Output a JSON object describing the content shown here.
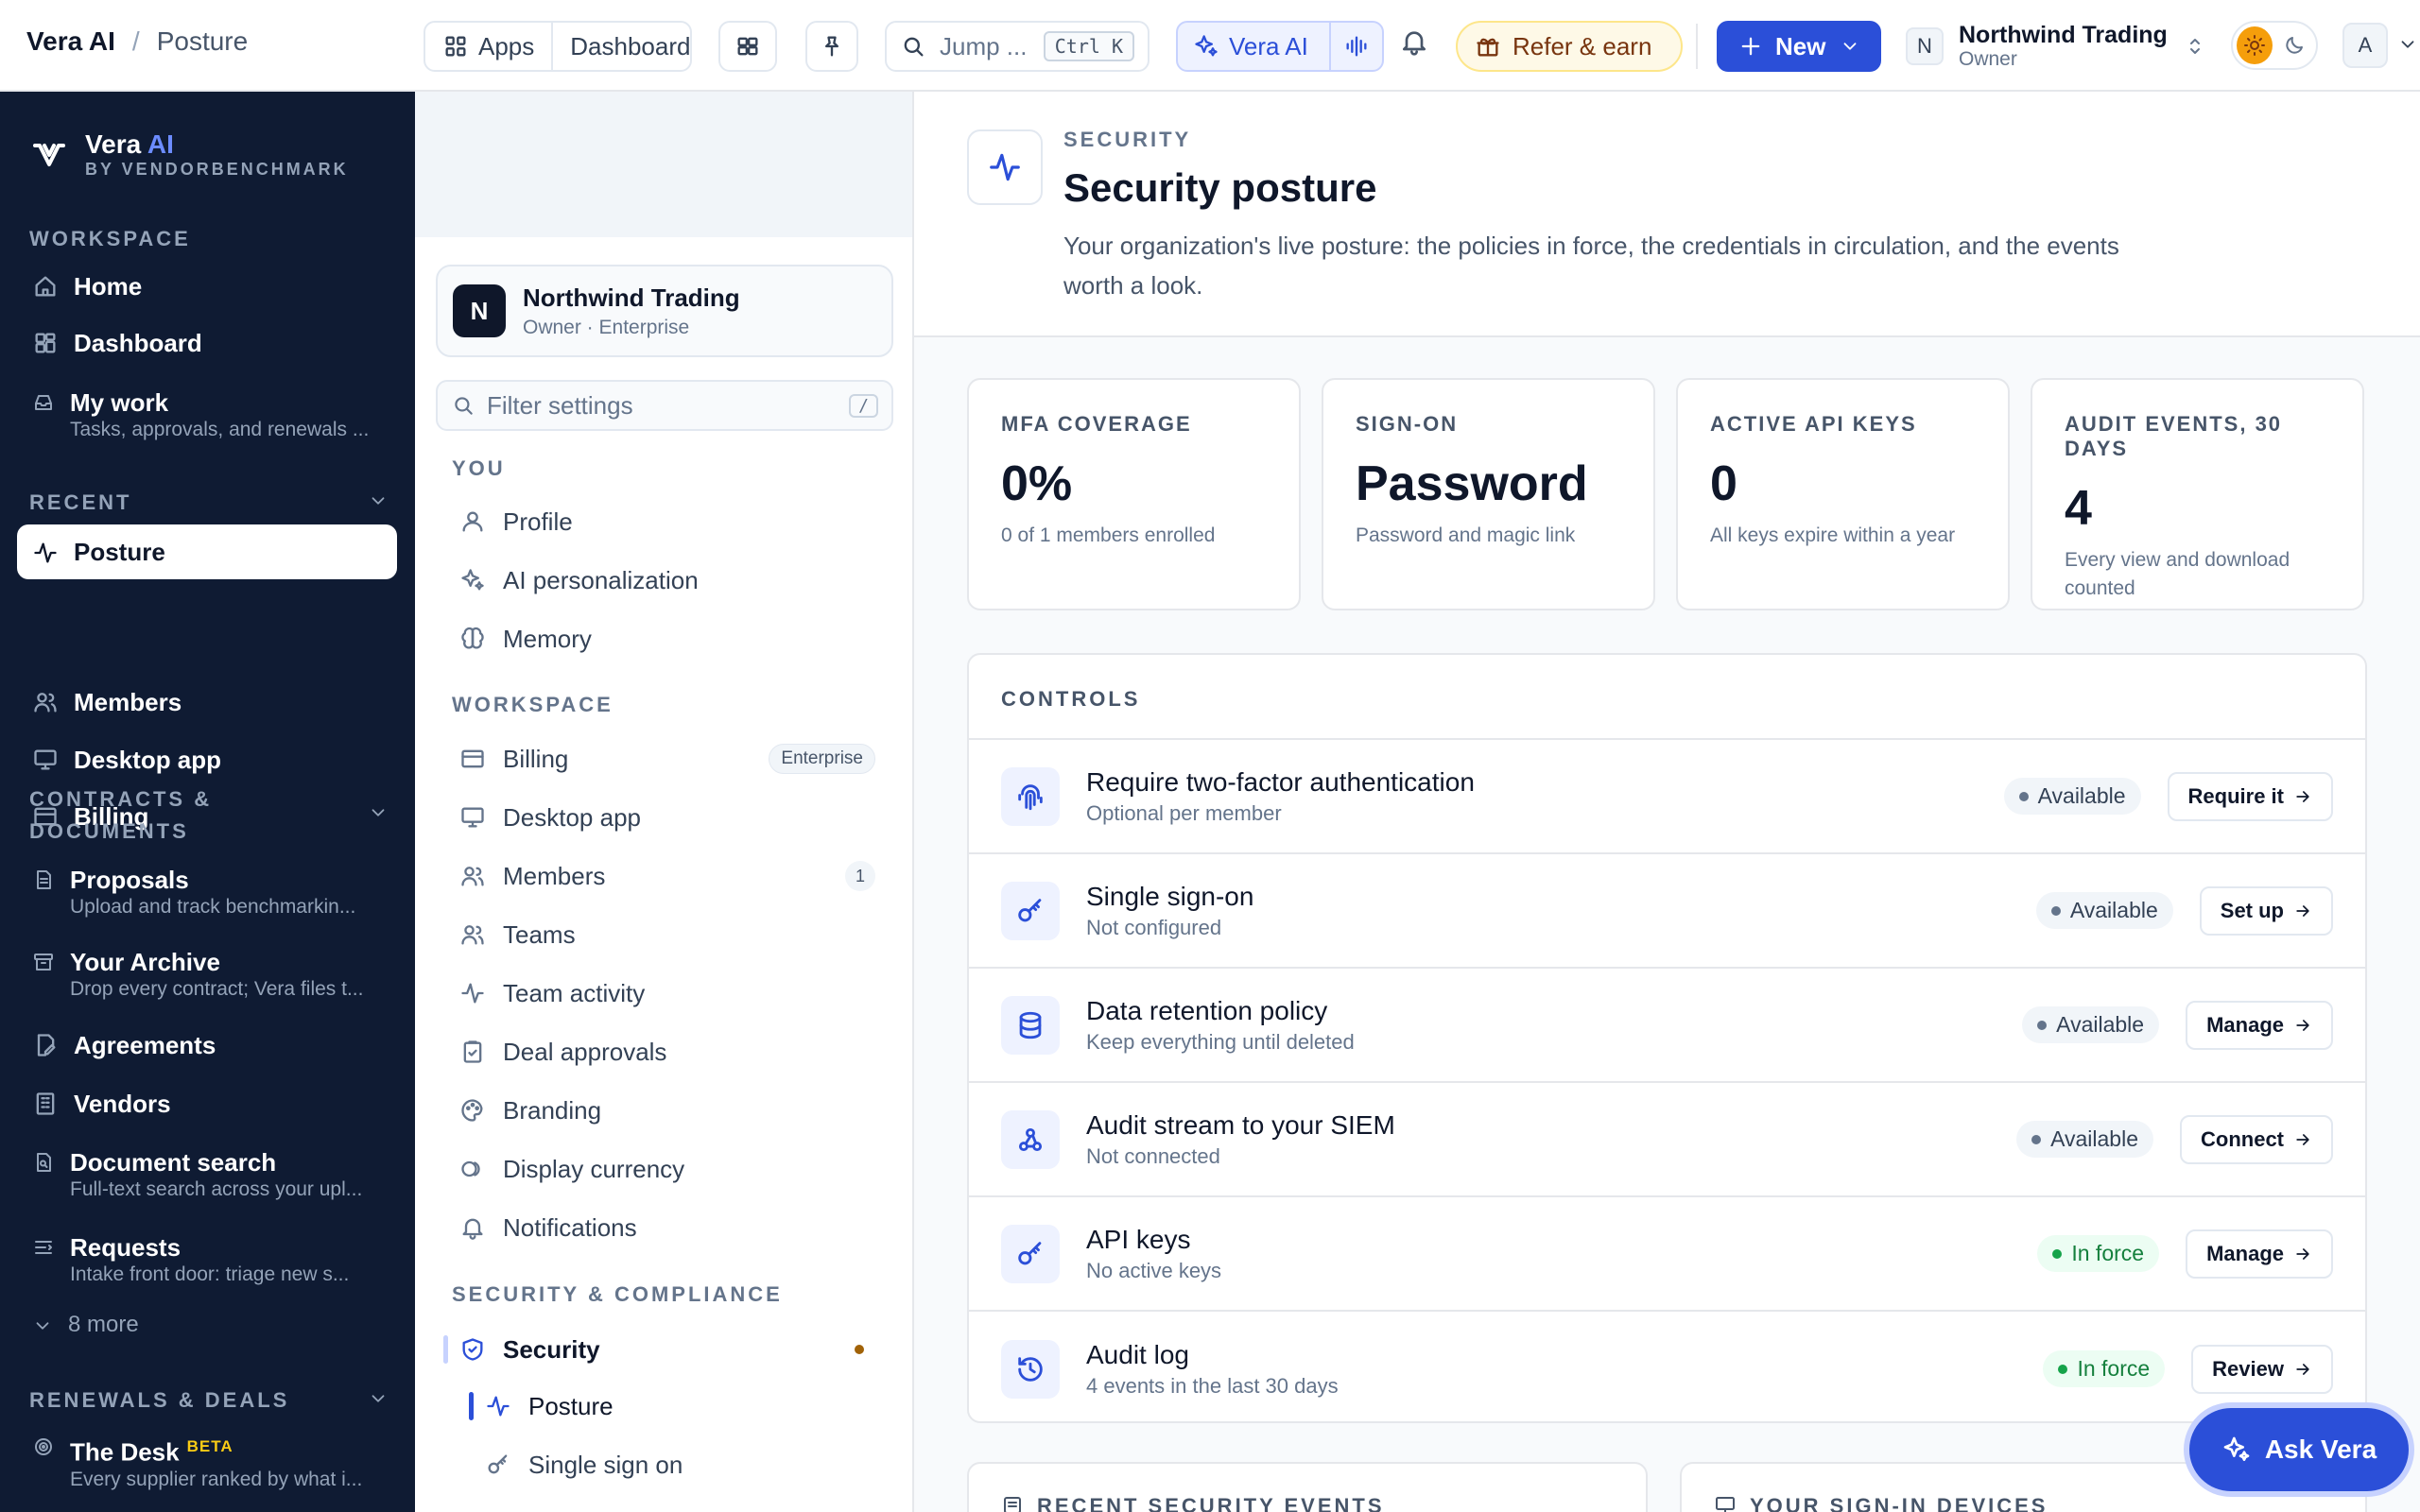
{
  "breadcrumb": {
    "app": "Vera AI",
    "separator": "/",
    "page": "Posture"
  },
  "topbar": {
    "apps_label": "Apps",
    "dashboard_label": "Dashboard",
    "search_placeholder": "Jump ...",
    "search_shortcut": "Ctrl K",
    "vera_label": "Vera AI",
    "refer_label": "Refer & earn",
    "new_label": "New",
    "org_initial": "N",
    "org_name": "Northwind Trading",
    "org_role": "Owner",
    "user_initial": "A"
  },
  "sidebar": {
    "brand_name": "Vera",
    "brand_ai": "AI",
    "brand_sub": "BY VENDORBENCHMARK",
    "workspace_heading": "WORKSPACE",
    "workspace_items": [
      {
        "label": "Home",
        "sub": ""
      },
      {
        "label": "Dashboard",
        "sub": ""
      },
      {
        "label": "My work",
        "sub": "Tasks, approvals, and renewals ..."
      }
    ],
    "recent_heading": "RECENT",
    "recent_items": [
      {
        "label": "Posture"
      },
      {
        "label": "Members"
      },
      {
        "label": "Desktop app"
      },
      {
        "label": "Billing"
      }
    ],
    "contracts_heading_1": "CONTRACTS &",
    "contracts_heading_2": "DOCUMENTS",
    "contracts_items": [
      {
        "label": "Proposals",
        "sub": "Upload and track benchmarkin..."
      },
      {
        "label": "Your Archive",
        "sub": "Drop every contract; Vera files t..."
      },
      {
        "label": "Agreements",
        "sub": ""
      },
      {
        "label": "Vendors",
        "sub": ""
      },
      {
        "label": "Document search",
        "sub": "Full-text search across your upl..."
      },
      {
        "label": "Requests",
        "sub": "Intake front door: triage new s..."
      }
    ],
    "more_label": "8 more",
    "renewals_heading": "RENEWALS & DEALS",
    "desk_label": "The Desk",
    "desk_badge": "BETA",
    "desk_sub": "Every supplier ranked by what i..."
  },
  "settings_nav": {
    "org_initial": "N",
    "org_name": "Northwind Trading",
    "org_meta": "Owner · Enterprise",
    "filter_placeholder": "Filter settings",
    "filter_shortcut": "/",
    "you_heading": "YOU",
    "you_items": [
      "Profile",
      "AI personalization",
      "Memory"
    ],
    "workspace_heading": "WORKSPACE",
    "billing_label": "Billing",
    "billing_badge": "Enterprise",
    "desktop_label": "Desktop app",
    "members_label": "Members",
    "members_count": "1",
    "teams_label": "Teams",
    "team_activity_label": "Team activity",
    "deal_approvals_label": "Deal approvals",
    "branding_label": "Branding",
    "display_currency_label": "Display currency",
    "notifications_label": "Notifications",
    "security_heading": "SECURITY & COMPLIANCE",
    "security_label": "Security",
    "posture_label": "Posture",
    "sso_label": "Single sign on"
  },
  "header": {
    "overline": "SECURITY",
    "title": "Security posture",
    "description": "Your organization's live posture: the policies in force, the credentials in circulation, and the events worth a look."
  },
  "stats": [
    {
      "label": "MFA COVERAGE",
      "value": "0%",
      "help": "0 of 1 members enrolled"
    },
    {
      "label": "SIGN-ON",
      "value": "Password",
      "help": "Password and magic link"
    },
    {
      "label": "ACTIVE API KEYS",
      "value": "0",
      "help": "All keys expire within a year"
    },
    {
      "label": "AUDIT EVENTS, 30 DAYS",
      "value": "4",
      "help": "Every view and download counted"
    }
  ],
  "controls": {
    "heading": "CONTROLS",
    "rows": [
      {
        "title": "Require two-factor authentication",
        "sub": "Optional per member",
        "status": "Available",
        "action": "Require it"
      },
      {
        "title": "Single sign-on",
        "sub": "Not configured",
        "status": "Available",
        "action": "Set up"
      },
      {
        "title": "Data retention policy",
        "sub": "Keep everything until deleted",
        "status": "Available",
        "action": "Manage"
      },
      {
        "title": "Audit stream to your SIEM",
        "sub": "Not connected",
        "status": "Available",
        "action": "Connect"
      },
      {
        "title": "API keys",
        "sub": "No active keys",
        "status": "In force",
        "action": "Manage"
      },
      {
        "title": "Audit log",
        "sub": "4 events in the last 30 days",
        "status": "In force",
        "action": "Review"
      }
    ]
  },
  "lower": {
    "events_heading": "RECENT SECURITY EVENTS",
    "devices_heading": "YOUR SIGN-IN DEVICES"
  },
  "ask_vera_label": "Ask Vera",
  "colors": {
    "accent": "#2b4fd8",
    "sidebar_bg": "#0f1b33",
    "in_force": "#16a34a"
  }
}
